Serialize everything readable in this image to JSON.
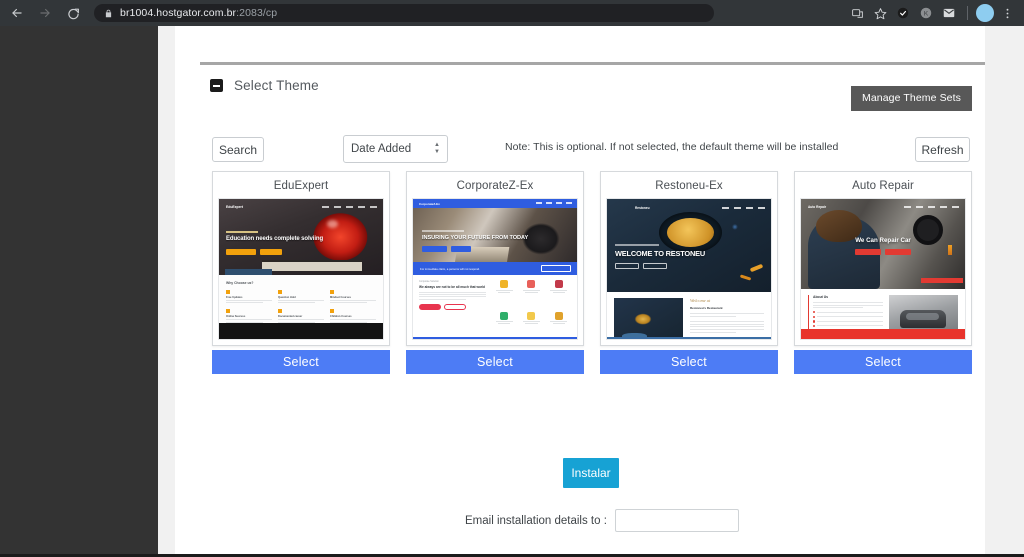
{
  "browser": {
    "back_icon": "back-arrow-icon",
    "forward_icon": "forward-arrow-icon",
    "reload_icon": "reload-icon",
    "lock_icon": "lock-icon",
    "url_host": "br1004.hostgator.com.br",
    "url_path": ":2083/cp",
    "toolbar_icons": [
      "cast-icon",
      "bookmark-star-icon",
      "extension-check-icon",
      "extension-circle-icon",
      "gmail-icon"
    ],
    "profile_avatar": "avatar",
    "menu_icon": "three-dot-menu-icon"
  },
  "section": {
    "title": "Select Theme",
    "collapse_icon": "collapse-minus-icon",
    "manage_button": "Manage Theme Sets"
  },
  "toolbar": {
    "search_button": "Search",
    "sort_value": "Date Added",
    "sort_spinner_icon": "spinner-arrows-icon",
    "note": "Note: This is optional. If not selected, the default theme will be installed",
    "refresh_button": "Refresh"
  },
  "themes": [
    {
      "name": "EduExpert",
      "select_label": "Select",
      "preview": {
        "brand": "EduExpert",
        "headline": "Education needs complete solviing",
        "section_title": "Why Choose us?",
        "features": [
          "Free Updates",
          "Question Hold",
          "Mindset Courses",
          "Online Success",
          "Documented career",
          "Children Courses"
        ],
        "accent": "#f2a10c"
      }
    },
    {
      "name": "CorporateZ-Ex",
      "select_label": "Select",
      "preview": {
        "brand": "CorporateZ-Ex",
        "headline": "INSURING YOUR FUTURE FROM TODAY",
        "kicker": "Corporate Solution",
        "body_title": "We always are not to be all much that world",
        "cta_text": "For immediate claim, a persons will not respond.",
        "accent": "#2f5de0",
        "accent2": "#e8344e"
      }
    },
    {
      "name": "Restoneu-Ex",
      "select_label": "Select",
      "preview": {
        "brand": "Restoneu",
        "headline": "WELCOME TO RESTONEU",
        "kicker": "TASTE OUR FOOD",
        "script_title": "Welcome at",
        "body_title": "Restoneu's Restaurant",
        "accent": "#3b6ea5"
      }
    },
    {
      "name": "Auto Repair",
      "select_label": "Select",
      "preview": {
        "brand": "Auto Repair",
        "headline": "We Can Repair Car",
        "body_title": "About Us",
        "accent": "#e8342c"
      }
    }
  ],
  "pager": {
    "next_icon": "chevron-right-icon"
  },
  "install": {
    "button_label": "Instalar",
    "email_label": "Email installation details to :",
    "email_value": "",
    "email_placeholder": ""
  },
  "colors": {
    "select_blue": "#4d7cf5",
    "install_cyan": "#17a2d4",
    "manage_gray": "#585858"
  }
}
